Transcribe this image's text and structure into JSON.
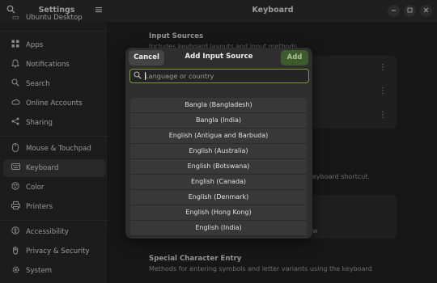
{
  "sidebar": {
    "title": "Settings",
    "partial_item": "Ubuntu Desktop",
    "items": [
      {
        "label": "Apps",
        "icon": "apps-icon"
      },
      {
        "label": "Notifications",
        "icon": "bell-icon"
      },
      {
        "label": "Search",
        "icon": "search-icon"
      },
      {
        "label": "Online Accounts",
        "icon": "cloud-icon"
      },
      {
        "label": "Sharing",
        "icon": "share-icon"
      },
      {
        "label": "Mouse & Touchpad",
        "icon": "mouse-icon"
      },
      {
        "label": "Keyboard",
        "icon": "keyboard-icon"
      },
      {
        "label": "Color",
        "icon": "color-icon"
      },
      {
        "label": "Printers",
        "icon": "printer-icon"
      },
      {
        "label": "Accessibility",
        "icon": "accessibility-icon"
      },
      {
        "label": "Privacy & Security",
        "icon": "hand-icon"
      },
      {
        "label": "System",
        "icon": "gear-icon"
      }
    ]
  },
  "header": {
    "title": "Keyboard"
  },
  "main": {
    "input_sources_title": "Input Sources",
    "input_sources_sub": "Includes keyboard layouts and input methods",
    "shortcut_sub_partial": "eyboard shortcut.",
    "partial_w": "w",
    "special_title": "Special Character Entry",
    "special_sub": "Methods for entering symbols and letter variants using the keyboard"
  },
  "dialog": {
    "title": "Add Input Source",
    "cancel_label": "Cancel",
    "add_label": "Add",
    "search_placeholder": "Language or country",
    "items": [
      "Bangla (Bangladesh)",
      "Bangla (India)",
      "English (Antigua and Barbuda)",
      "English (Australia)",
      "English (Botswana)",
      "English (Canada)",
      "English (Denmark)",
      "English (Hong Kong)",
      "English (India)"
    ]
  },
  "colors": {
    "accent": "#7c9a3a",
    "add_button": "#3e5b2b"
  }
}
